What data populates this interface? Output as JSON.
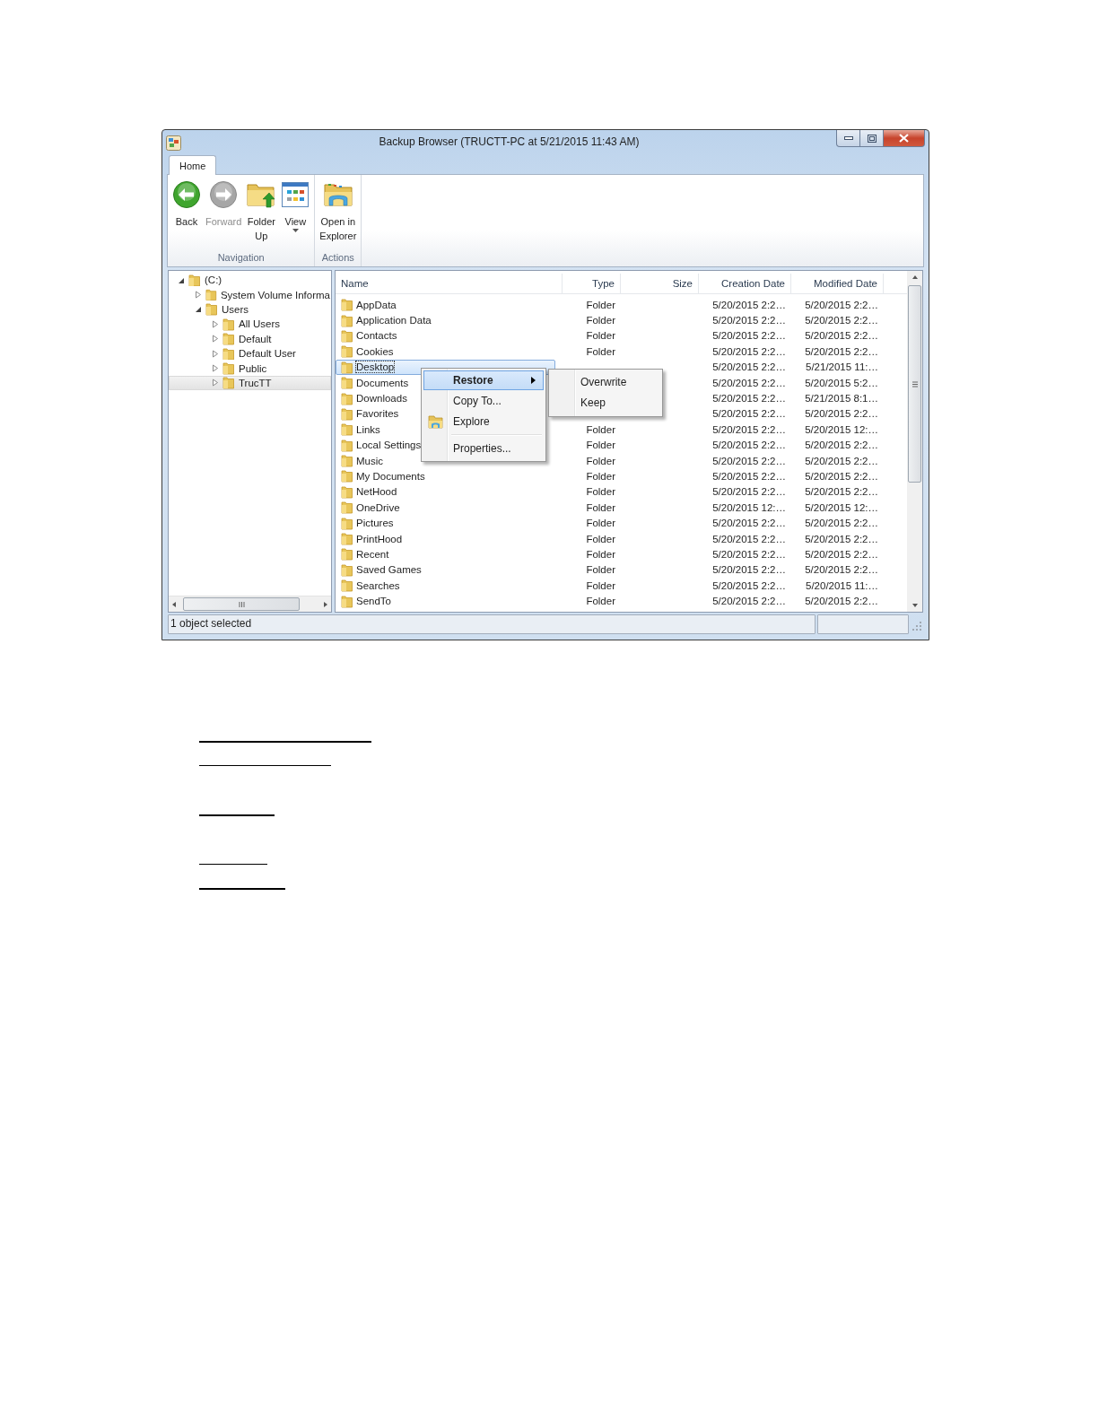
{
  "window": {
    "title": "Backup Browser (TRUCTT-PC at 5/21/2015 11:43 AM)"
  },
  "ribbon": {
    "tabs": [
      {
        "label": "Home",
        "selected": true
      }
    ],
    "groups": [
      {
        "label": "Navigation",
        "buttons": [
          {
            "kind": "back",
            "label": "Back",
            "disabled": false,
            "dropdown": false
          },
          {
            "kind": "forward",
            "label": "Forward",
            "disabled": true,
            "dropdown": false
          },
          {
            "kind": "folder-up",
            "label": "Folder\nUp",
            "disabled": false,
            "dropdown": false
          },
          {
            "kind": "view",
            "label": "View",
            "disabled": false,
            "dropdown": true
          }
        ]
      },
      {
        "label": "Actions",
        "buttons": [
          {
            "kind": "explorer",
            "label": "Open in\nExplorer",
            "disabled": false,
            "dropdown": false
          }
        ]
      }
    ]
  },
  "tree": {
    "items": [
      {
        "label": "(C:)",
        "expanded": true,
        "selected": false,
        "children": [
          {
            "label": "System Volume Informa",
            "expanded": false,
            "selected": false
          },
          {
            "label": "Users",
            "expanded": true,
            "selected": false,
            "children": [
              {
                "label": "All Users",
                "expanded": false,
                "selected": false
              },
              {
                "label": "Default",
                "expanded": false,
                "selected": false
              },
              {
                "label": "Default User",
                "expanded": false,
                "selected": false
              },
              {
                "label": "Public",
                "expanded": false,
                "selected": false
              },
              {
                "label": "TrucTT",
                "expanded": false,
                "selected": true
              }
            ]
          }
        ]
      }
    ]
  },
  "file_list": {
    "columns": [
      "Name",
      "Type",
      "Size",
      "Creation Date",
      "Modified Date"
    ],
    "rows": [
      {
        "name": "AppData",
        "type": "Folder",
        "created": "5/20/2015 2:2…",
        "modified": "5/20/2015 2:2…",
        "selected": false
      },
      {
        "name": "Application Data",
        "type": "Folder",
        "created": "5/20/2015 2:2…",
        "modified": "5/20/2015 2:2…",
        "selected": false
      },
      {
        "name": "Contacts",
        "type": "Folder",
        "created": "5/20/2015 2:2…",
        "modified": "5/20/2015 2:2…",
        "selected": false
      },
      {
        "name": "Cookies",
        "type": "Folder",
        "created": "5/20/2015 2:2…",
        "modified": "5/20/2015 2:2…",
        "selected": false
      },
      {
        "name": "Desktop",
        "created": "5/20/2015 2:2…",
        "modified": "5/21/2015 11:…",
        "selected": true
      },
      {
        "name": "Documents",
        "created": "5/20/2015 2:2…",
        "modified": "5/20/2015 5:2…",
        "selected": false
      },
      {
        "name": "Downloads",
        "created": "5/20/2015 2:2…",
        "modified": "5/21/2015 8:1…",
        "selected": false
      },
      {
        "name": "Favorites",
        "created": "5/20/2015 2:2…",
        "modified": "5/20/2015 2:2…",
        "selected": false
      },
      {
        "name": "Links",
        "type": "Folder",
        "created": "5/20/2015 2:2…",
        "modified": "5/20/2015 12:…",
        "selected": false
      },
      {
        "name": "Local Settings",
        "type": "Folder",
        "created": "5/20/2015 2:2…",
        "modified": "5/20/2015 2:2…",
        "selected": false
      },
      {
        "name": "Music",
        "type": "Folder",
        "created": "5/20/2015 2:2…",
        "modified": "5/20/2015 2:2…",
        "selected": false
      },
      {
        "name": "My Documents",
        "type": "Folder",
        "created": "5/20/2015 2:2…",
        "modified": "5/20/2015 2:2…",
        "selected": false
      },
      {
        "name": "NetHood",
        "type": "Folder",
        "created": "5/20/2015 2:2…",
        "modified": "5/20/2015 2:2…",
        "selected": false
      },
      {
        "name": "OneDrive",
        "type": "Folder",
        "created": "5/20/2015 12:…",
        "modified": "5/20/2015 12:…",
        "selected": false
      },
      {
        "name": "Pictures",
        "type": "Folder",
        "created": "5/20/2015 2:2…",
        "modified": "5/20/2015 2:2…",
        "selected": false
      },
      {
        "name": "PrintHood",
        "type": "Folder",
        "created": "5/20/2015 2:2…",
        "modified": "5/20/2015 2:2…",
        "selected": false
      },
      {
        "name": "Recent",
        "type": "Folder",
        "created": "5/20/2015 2:2…",
        "modified": "5/20/2015 2:2…",
        "selected": false
      },
      {
        "name": "Saved Games",
        "type": "Folder",
        "created": "5/20/2015 2:2…",
        "modified": "5/20/2015 2:2…",
        "selected": false
      },
      {
        "name": "Searches",
        "type": "Folder",
        "created": "5/20/2015 2:2…",
        "modified": "5/20/2015 11:…",
        "selected": false
      },
      {
        "name": "SendTo",
        "type": "Folder",
        "created": "5/20/2015 2:2…",
        "modified": "5/20/2015 2:2…",
        "selected": false
      }
    ]
  },
  "context_menu": {
    "items": [
      {
        "kind": "item",
        "label": "Restore",
        "selected": true,
        "default": true,
        "submenu": true,
        "has_icon": false
      },
      {
        "kind": "item",
        "label": "Copy To...",
        "selected": false,
        "default": false,
        "submenu": false,
        "has_icon": false
      },
      {
        "kind": "item",
        "label": "Explore",
        "selected": false,
        "default": false,
        "submenu": false,
        "has_icon": true
      },
      {
        "kind": "separator"
      },
      {
        "kind": "item",
        "label": "Properties...",
        "selected": false,
        "default": false,
        "submenu": false,
        "has_icon": false
      }
    ]
  },
  "submenu": {
    "items": [
      {
        "label": "Overwrite"
      },
      {
        "label": "Keep"
      }
    ]
  },
  "status_bar": {
    "text": "1 object selected"
  }
}
